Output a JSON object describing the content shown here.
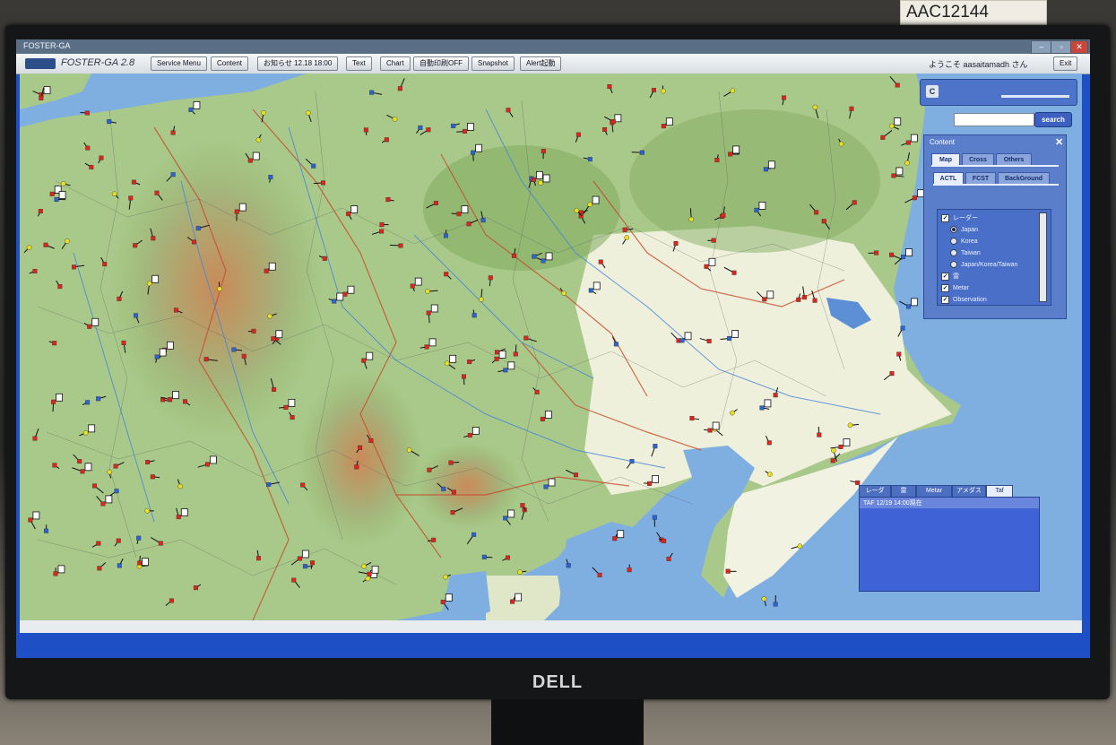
{
  "environment": {
    "monitor_brand": "DELL",
    "sticker_code": "AAC12144"
  },
  "window": {
    "title": "FOSTER-GA"
  },
  "toolbar": {
    "app_title": "FOSTER-GA 2.8",
    "buttons": [
      "Service Menu",
      "Content",
      "お知らせ 12.18 18:00",
      "Text",
      "Chart",
      "自動印刷OFF",
      "Snapshot",
      "Alert起動"
    ],
    "welcome": "ようこそ aasaitamadh さん",
    "exit_label": "Exit"
  },
  "search": {
    "placeholder": "",
    "button_label": "search"
  },
  "slider": {
    "button_label": "C"
  },
  "content_panel": {
    "title": "Content",
    "tabs": [
      "Map",
      "Cross",
      "Others"
    ],
    "subtabs": [
      "ACTL",
      "FCST",
      "BackGround"
    ],
    "layers": [
      {
        "type": "check",
        "checked": true,
        "label": "レーダー"
      },
      {
        "type": "radio",
        "checked": true,
        "label": "Japan"
      },
      {
        "type": "radio",
        "checked": false,
        "label": "Korea"
      },
      {
        "type": "radio",
        "checked": false,
        "label": "Taiwan"
      },
      {
        "type": "radio",
        "checked": false,
        "label": "Japan/Korea/Taiwan"
      },
      {
        "type": "check",
        "checked": true,
        "label": "雷"
      },
      {
        "type": "check",
        "checked": true,
        "label": "Metar"
      },
      {
        "type": "check",
        "checked": true,
        "label": "Observation"
      }
    ]
  },
  "info_panel": {
    "tabs": [
      "レーダ",
      "雷",
      "Metar",
      "アメダス",
      "Taf"
    ],
    "active_tab": "Taf",
    "header": "TAF 12/19 14:00現在"
  },
  "colors": {
    "screen_bg": "#1e4fc4",
    "land": "#9cc078",
    "sea": "#7faee0",
    "station_red": "#e0241c",
    "station_yellow": "#e8e020",
    "station_blue": "#2a62d8"
  }
}
